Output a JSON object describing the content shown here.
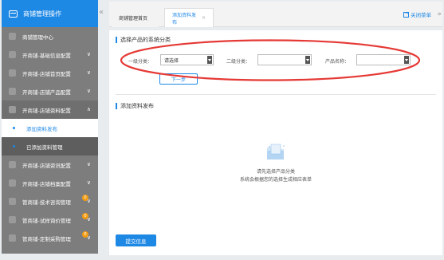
{
  "sidebar": {
    "title": "商铺管理操作",
    "items": [
      {
        "label": "商铺管理中心"
      },
      {
        "label": "开商铺-基础信息配置"
      },
      {
        "label": "开商铺-店铺首页配置"
      },
      {
        "label": "开商铺-店铺产品配置"
      },
      {
        "label": "开商铺-店铺资料配置"
      }
    ],
    "sub_items": [
      {
        "label": "添加资料发布"
      },
      {
        "label": "已添加资料管理"
      }
    ],
    "items_after": [
      {
        "label": "开商铺-店铺资讯配置"
      },
      {
        "label": "开商铺-店铺档案配置"
      },
      {
        "label": "管商铺-技术咨询管理",
        "badge": "0"
      },
      {
        "label": "管商铺-试样询价管理",
        "badge": "0"
      },
      {
        "label": "管商铺-定制采购管理",
        "badge": "0"
      }
    ]
  },
  "tabs": [
    {
      "label": "商铺管理首页"
    },
    {
      "label": "添加资料发布",
      "close": "×"
    }
  ],
  "toolbar": {
    "close_all": "关闭菜单",
    "collapse": "«",
    "more": "»"
  },
  "section1": {
    "title": "选择产品的系统分类",
    "level1_label": "一级分类：",
    "level1_value": "请选择",
    "level2_label": "二级分类：",
    "level2_value": "",
    "product_label": "产品名称：",
    "product_value": "",
    "next_button": "下一步"
  },
  "section2": {
    "title": "添加资料发布",
    "empty_line1": "请先选择产品分类",
    "empty_line2": "系统会根据您的选择生成相应表单",
    "submit_button": "提交信息"
  },
  "colors": {
    "accent": "#1e88e5",
    "sidebar": "#7d7d7d",
    "annotation": "#e53935",
    "badge": "#f39c12"
  }
}
